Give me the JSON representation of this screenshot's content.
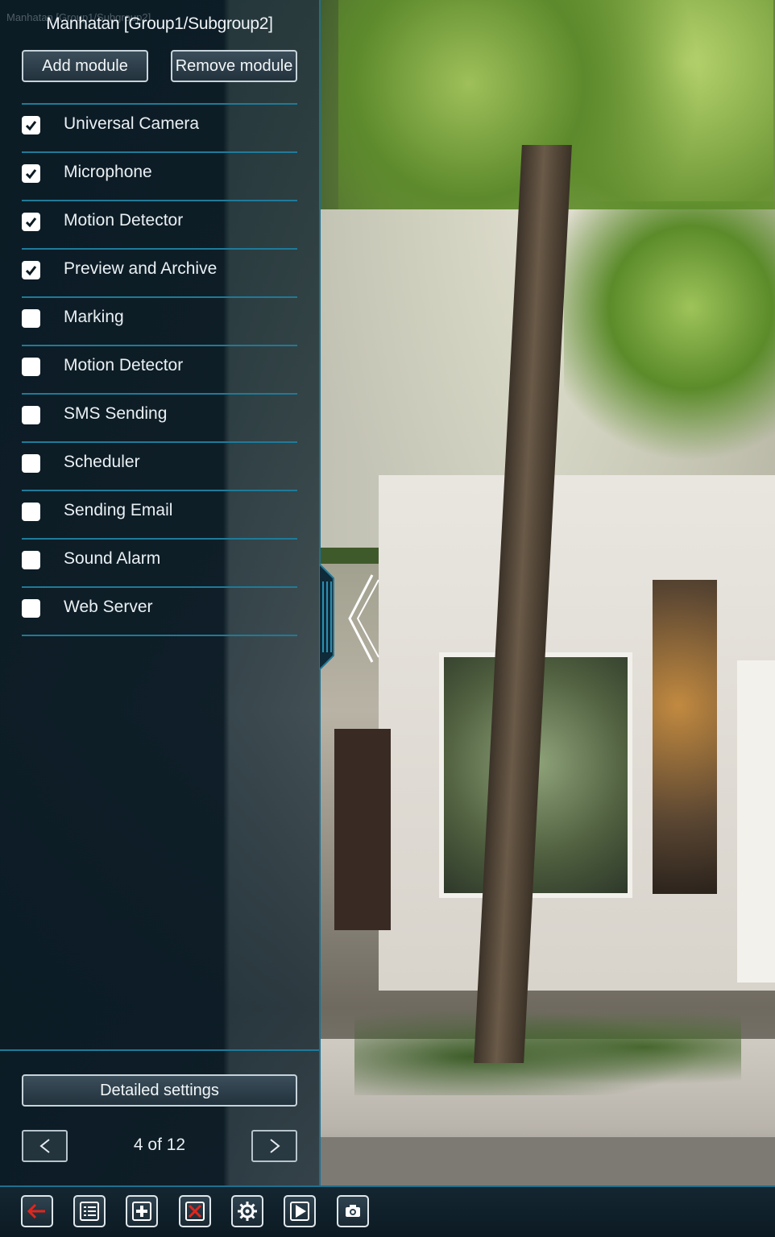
{
  "camera": {
    "caption": "Manhatan [Group1/Subgroup2]"
  },
  "panel": {
    "title": "Manhatan [Group1/Subgroup2]",
    "add_module_label": "Add module",
    "remove_module_label": "Remove module",
    "modules": [
      {
        "label": "Universal Camera",
        "checked": true
      },
      {
        "label": "Microphone",
        "checked": true
      },
      {
        "label": "Motion Detector",
        "checked": true
      },
      {
        "label": "Preview and Archive",
        "checked": true
      },
      {
        "label": "Marking",
        "checked": false
      },
      {
        "label": "Motion Detector",
        "checked": false
      },
      {
        "label": "SMS Sending",
        "checked": false
      },
      {
        "label": "Scheduler",
        "checked": false
      },
      {
        "label": "Sending Email",
        "checked": false
      },
      {
        "label": "Sound Alarm",
        "checked": false
      },
      {
        "label": "Web Server",
        "checked": false
      }
    ],
    "detailed_settings_label": "Detailed settings",
    "page_indicator": "4 of 12"
  },
  "toolbar": {
    "buttons": [
      "back-arrow-icon",
      "list-icon",
      "plus-icon",
      "delete-x-icon",
      "gear-icon",
      "play-icon",
      "camera-icon"
    ]
  },
  "colors": {
    "accent": "#1f7a99",
    "panel_bg": "#0a1a24",
    "delete_red": "#e0261d"
  }
}
